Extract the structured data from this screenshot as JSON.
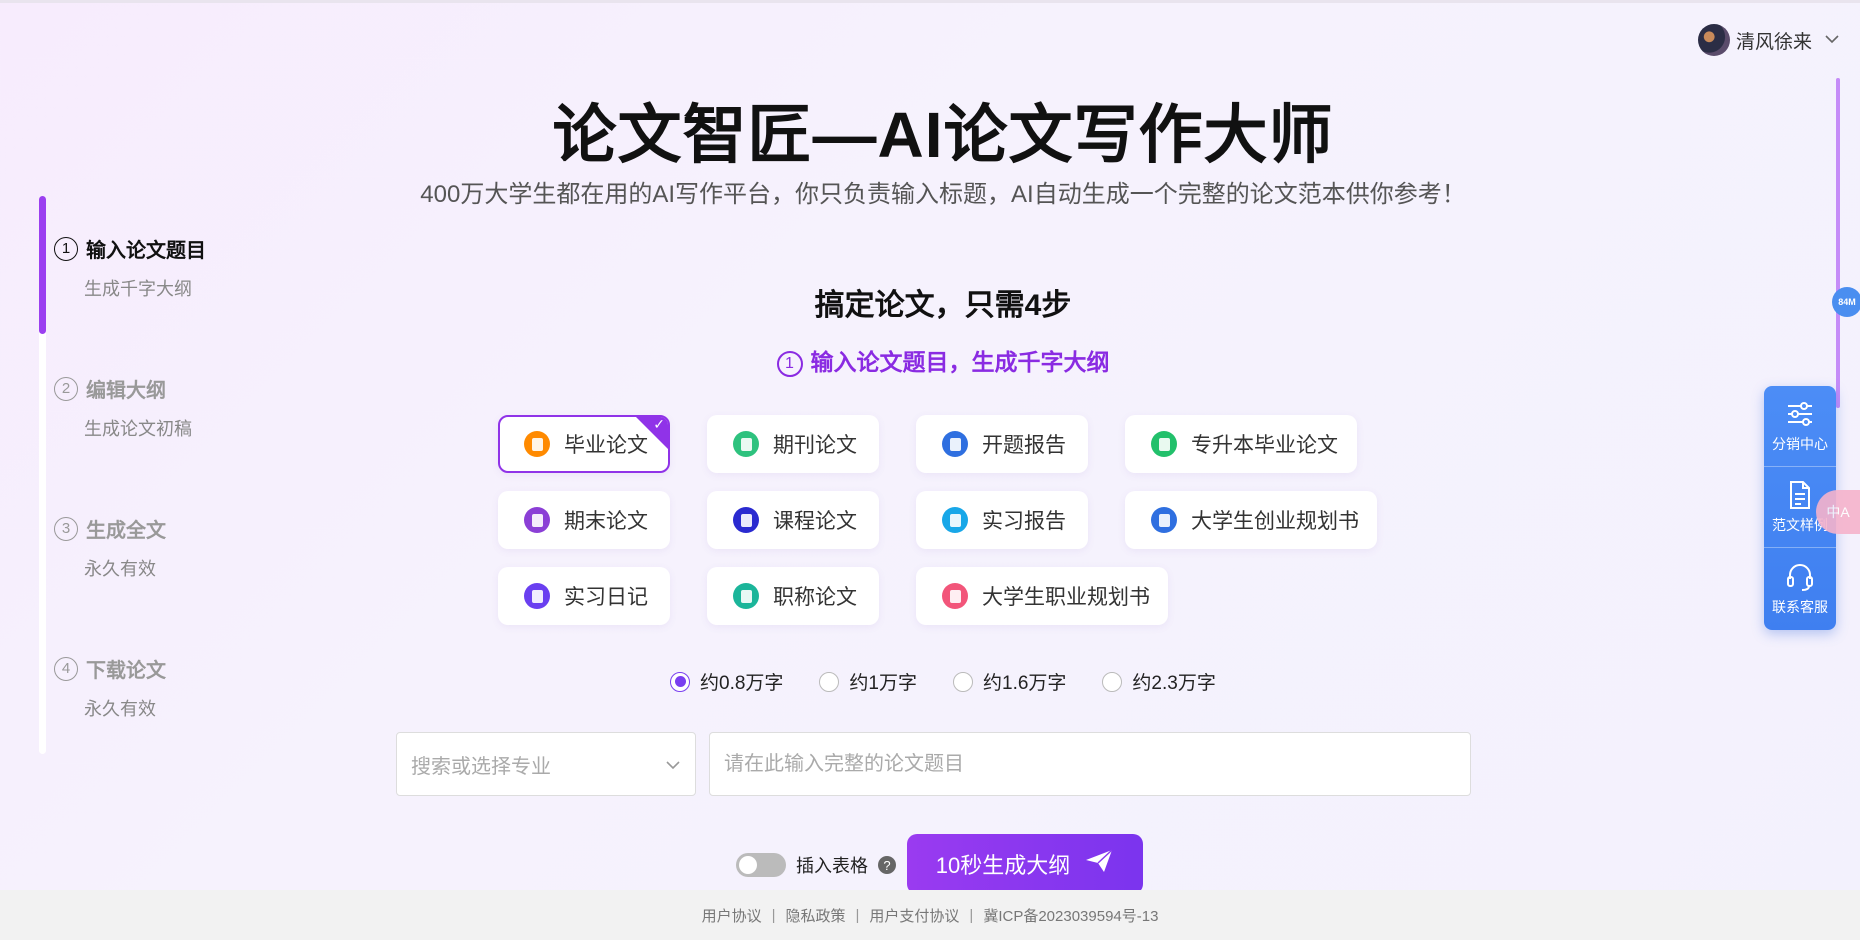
{
  "user": {
    "name": "清风徐来"
  },
  "header": {
    "title": "论文智匠—AI论文写作大师",
    "subtitle": "400万大学生都在用的AI写作平台，你只负责输入标题，AI自动生成一个完整的论文范本供你参考！"
  },
  "steps": [
    {
      "num": "1",
      "title": "输入论文题目",
      "sub": "生成千字大纲"
    },
    {
      "num": "2",
      "title": "编辑大纲",
      "sub": "生成论文初稿"
    },
    {
      "num": "3",
      "title": "生成全文",
      "sub": "永久有效"
    },
    {
      "num": "4",
      "title": "下载论文",
      "sub": "永久有效"
    }
  ],
  "main": {
    "heading": "搞定论文，只需4步",
    "step_num": "1",
    "step_title": "输入论文题目，生成千字大纲",
    "types": [
      {
        "label": "毕业论文",
        "color": "#ff8a00"
      },
      {
        "label": "期刊论文",
        "color": "#2ec27e"
      },
      {
        "label": "开题报告",
        "color": "#2f6fe0"
      },
      {
        "label": "专升本毕业论文",
        "color": "#22c06b"
      },
      {
        "label": "期末论文",
        "color": "#8b3fd6"
      },
      {
        "label": "课程论文",
        "color": "#2a2ad0"
      },
      {
        "label": "实习报告",
        "color": "#18a7e8"
      },
      {
        "label": "大学生创业规划书",
        "color": "#2f6fe0"
      },
      {
        "label": "实习日记",
        "color": "#6a3ff0"
      },
      {
        "label": "职称论文",
        "color": "#1bb59a"
      },
      {
        "label": "大学生职业规划书",
        "color": "#f2557a"
      }
    ],
    "selected_type": "毕业论文",
    "word_counts": [
      "约0.8万字",
      "约1万字",
      "约1.6万字",
      "约2.3万字"
    ],
    "selected_word_count": "约0.8万字",
    "major_placeholder": "搜索或选择专业",
    "topic_placeholder": "请在此输入完整的论文题目",
    "insert_table_label": "插入表格",
    "help_symbol": "?",
    "generate_label": "10秒生成大纲"
  },
  "float_panel": {
    "items": [
      {
        "label": "分销中心",
        "icon": "sliders-icon"
      },
      {
        "label": "范文样例",
        "icon": "document-icon"
      },
      {
        "label": "联系客服",
        "icon": "headset-icon"
      }
    ],
    "memory_badge": "84M",
    "translate_label": "中A"
  },
  "footer": {
    "links": [
      "用户协议",
      "隐私政策",
      "用户支付协议",
      "冀ICP备2023039594号-13"
    ],
    "separator": "|"
  }
}
